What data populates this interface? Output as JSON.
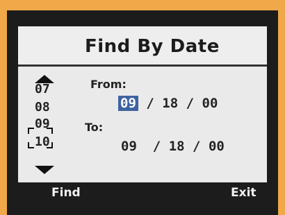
{
  "title": "Find By Date",
  "spinner": {
    "values": [
      "07",
      "08",
      "09",
      "10"
    ],
    "selected": "09"
  },
  "from": {
    "label": "From:",
    "month": "09",
    "day": "18",
    "year": "00",
    "separator": "/"
  },
  "to": {
    "label": "To:",
    "month": "09",
    "day": "18",
    "year": "00",
    "separator": "/"
  },
  "footer": {
    "find_label": "Find",
    "exit_label": "Exit"
  },
  "colors": {
    "highlight": "#3f63a0",
    "background": "#f0a848"
  }
}
